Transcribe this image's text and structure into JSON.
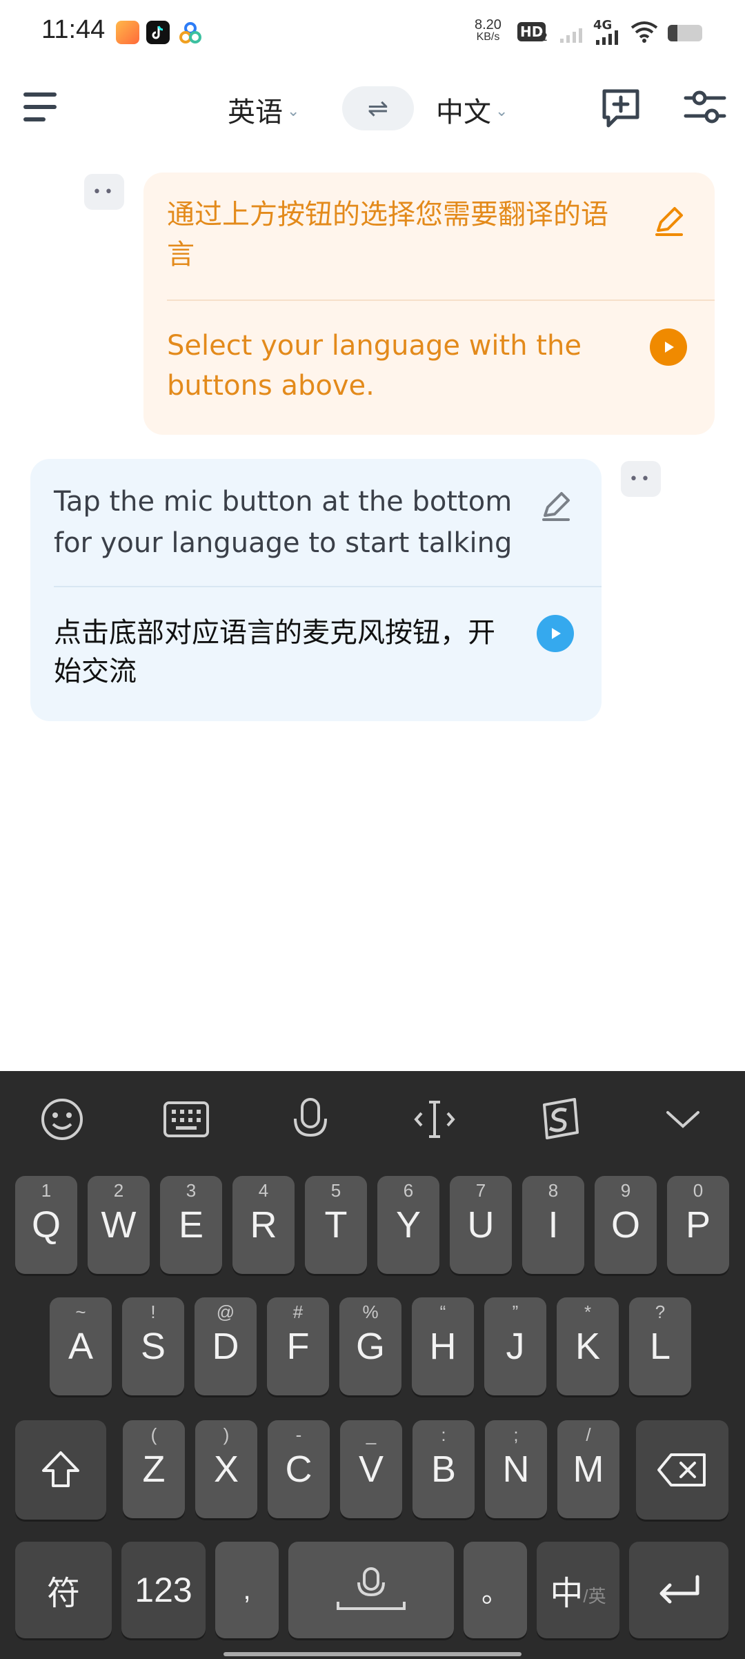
{
  "status_bar": {
    "time": "11:44",
    "net_speed_value": "8.20",
    "net_speed_unit": "KB/s",
    "hd_label": "HD",
    "hd_sub": "2",
    "network_label": "4G"
  },
  "toolbar": {
    "source_language": "英语",
    "target_language": "中文"
  },
  "messages": [
    {
      "side": "right",
      "color": "#e38a1b",
      "original": "通过上方按钮的选择您需要翻译的语言",
      "translation": "Select your language with the buttons above."
    },
    {
      "side": "left",
      "color": "#3aa7e8",
      "original": "Tap the mic button at the bottom for your language to start talking",
      "translation": "点击底部对应语言的麦克风按钮，开始交流"
    }
  ],
  "keyboard": {
    "row1": [
      {
        "sub": "1",
        "main": "Q"
      },
      {
        "sub": "2",
        "main": "W"
      },
      {
        "sub": "3",
        "main": "E"
      },
      {
        "sub": "4",
        "main": "R"
      },
      {
        "sub": "5",
        "main": "T"
      },
      {
        "sub": "6",
        "main": "Y"
      },
      {
        "sub": "7",
        "main": "U"
      },
      {
        "sub": "8",
        "main": "I"
      },
      {
        "sub": "9",
        "main": "O"
      },
      {
        "sub": "0",
        "main": "P"
      }
    ],
    "row2": [
      {
        "sub": "~",
        "main": "A"
      },
      {
        "sub": "!",
        "main": "S"
      },
      {
        "sub": "@",
        "main": "D"
      },
      {
        "sub": "#",
        "main": "F"
      },
      {
        "sub": "%",
        "main": "G"
      },
      {
        "sub": "“",
        "main": "H"
      },
      {
        "sub": "”",
        "main": "J"
      },
      {
        "sub": "*",
        "main": "K"
      },
      {
        "sub": "?",
        "main": "L"
      }
    ],
    "row3": [
      {
        "sub": "(",
        "main": "Z"
      },
      {
        "sub": ")",
        "main": "X"
      },
      {
        "sub": "-",
        "main": "C"
      },
      {
        "sub": "_",
        "main": "V"
      },
      {
        "sub": ":",
        "main": "B"
      },
      {
        "sub": ";",
        "main": "N"
      },
      {
        "sub": "/",
        "main": "M"
      }
    ],
    "symbols_label": "符",
    "numbers_label": "123",
    "comma_label": ",",
    "period_label": "。",
    "lang_switch_main": "中",
    "lang_switch_sub": "/英"
  },
  "colors": {
    "accent_orange": "#f08a00",
    "accent_blue": "#35a9ee"
  }
}
